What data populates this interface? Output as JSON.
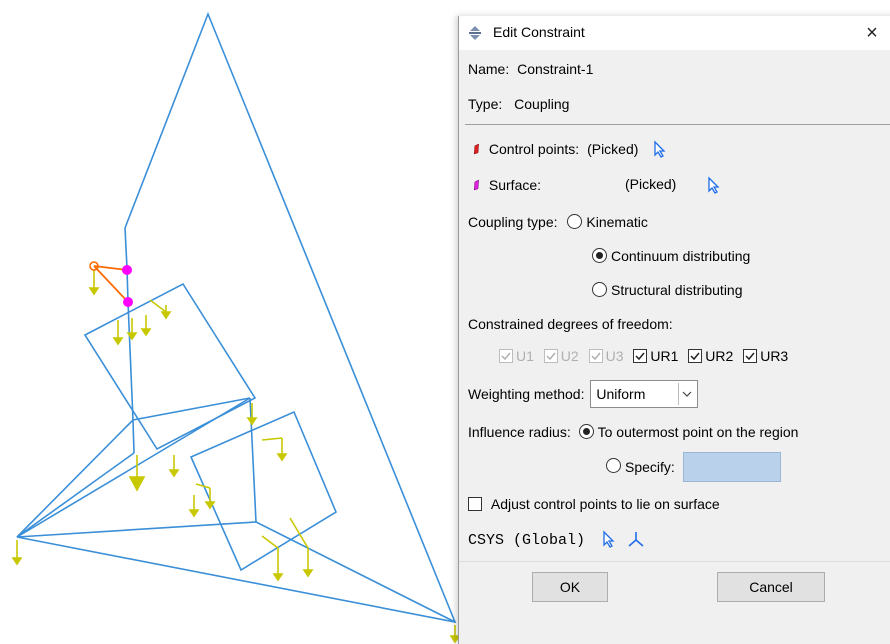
{
  "dialog": {
    "title": "Edit Constraint",
    "close_symbol": "×",
    "name_label": "Name:",
    "name_value": "Constraint-1",
    "type_label": "Type:",
    "type_value": "Coupling",
    "control_points_label": "Control points:",
    "control_points_value": "(Picked)",
    "surface_label": "Surface:",
    "surface_value": "(Picked)",
    "coupling_type_label": "Coupling type:",
    "coupling_options": [
      {
        "label": "Kinematic",
        "checked": false
      },
      {
        "label": "Continuum distributing",
        "checked": true
      },
      {
        "label": "Structural distributing",
        "checked": false
      }
    ],
    "dof_label": "Constrained degrees of freedom:",
    "dof": [
      {
        "label": "U1",
        "checked": true,
        "enabled": false
      },
      {
        "label": "U2",
        "checked": true,
        "enabled": false
      },
      {
        "label": "U3",
        "checked": true,
        "enabled": false
      },
      {
        "label": "UR1",
        "checked": true,
        "enabled": true
      },
      {
        "label": "UR2",
        "checked": true,
        "enabled": true
      },
      {
        "label": "UR3",
        "checked": true,
        "enabled": true
      }
    ],
    "weighting_label": "Weighting method:",
    "weighting_value": "Uniform",
    "influence_label": "Influence radius:",
    "influence_option_1": "To outermost point on the region",
    "influence_option_2": "Specify:",
    "specify_value": "",
    "adjust_label": "Adjust control points to lie on surface",
    "csys_label": "CSYS (Global)",
    "ok_label": "OK",
    "cancel_label": "Cancel"
  },
  "colors": {
    "mesh_line": "#3a8fd8",
    "load_symbol": "#c8c800",
    "control_point": "#ff00ff",
    "reference_point": "#ff8c00",
    "specify_field": "#b9d1ea"
  },
  "icons": [
    "constraint-icon",
    "close-icon",
    "control-points-icon",
    "surface-icon",
    "pick-arrow-icon",
    "csys-axis-icon"
  ]
}
